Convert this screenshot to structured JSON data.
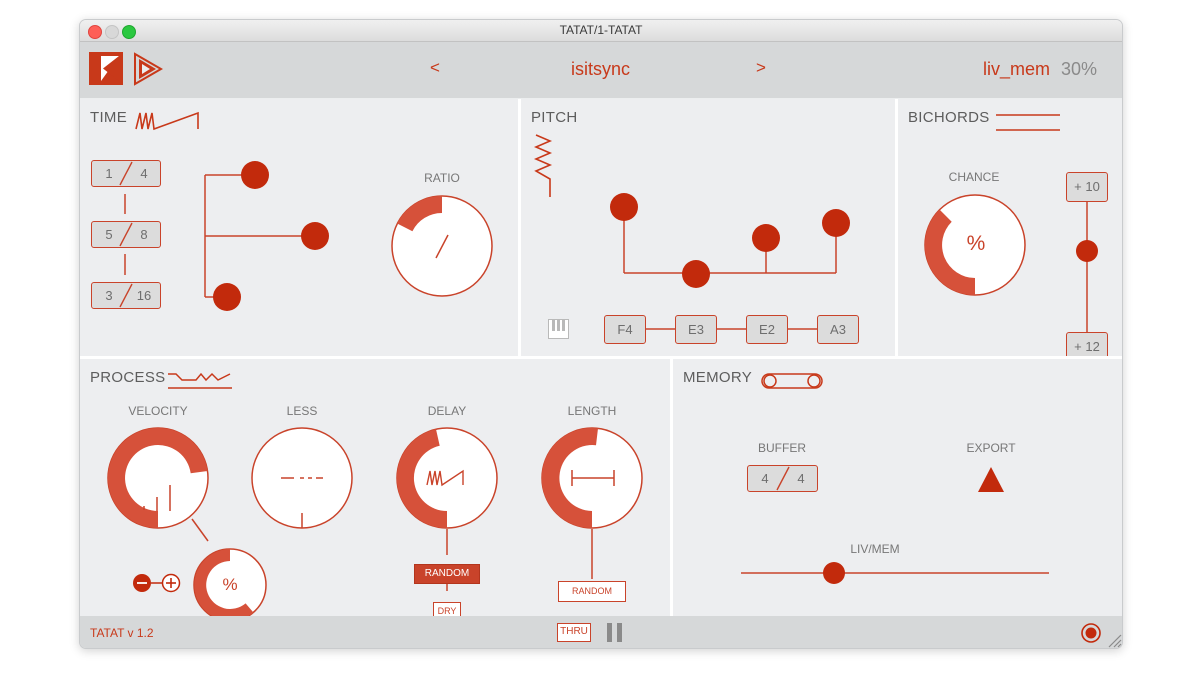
{
  "window": {
    "title": "TATAT/1-TATAT"
  },
  "header": {
    "prev_label": "<",
    "next_label": ">",
    "preset_name": "isitsync",
    "mem_label": "liv_mem",
    "mem_percent": "30%"
  },
  "time": {
    "title": "TIME",
    "ratio_label": "RATIO",
    "ratios": [
      {
        "num": "1",
        "den": "4"
      },
      {
        "num": "5",
        "den": "8"
      },
      {
        "num": "3",
        "den": "16"
      }
    ]
  },
  "pitch": {
    "title": "PITCH",
    "notes": [
      "F4",
      "E3",
      "E2",
      "A3"
    ]
  },
  "bichords": {
    "title": "BICHORDS",
    "chance_label": "CHANCE",
    "chance_symbol": "%",
    "top_value": "+ 10",
    "bottom_value": "+ 12"
  },
  "process": {
    "title": "PROCESS",
    "velocity_label": "VELOCITY",
    "less_label": "LESS",
    "delay_label": "DELAY",
    "length_label": "LENGTH",
    "percent_symbol": "%",
    "random_label": "RANDOM",
    "dry_label": "DRY",
    "length_random_label": "RANDOM"
  },
  "memory": {
    "title": "MEMORY",
    "buffer_label": "BUFFER",
    "buffer_num": "4",
    "buffer_den": "4",
    "export_label": "EXPORT",
    "livmem_label": "LIV/MEM"
  },
  "footer": {
    "version": "TATAT v 1.2",
    "thru_label": "THRU"
  },
  "colors": {
    "accent": "#c8391a",
    "panel": "#edeef0",
    "header": "#d6d8d9"
  }
}
